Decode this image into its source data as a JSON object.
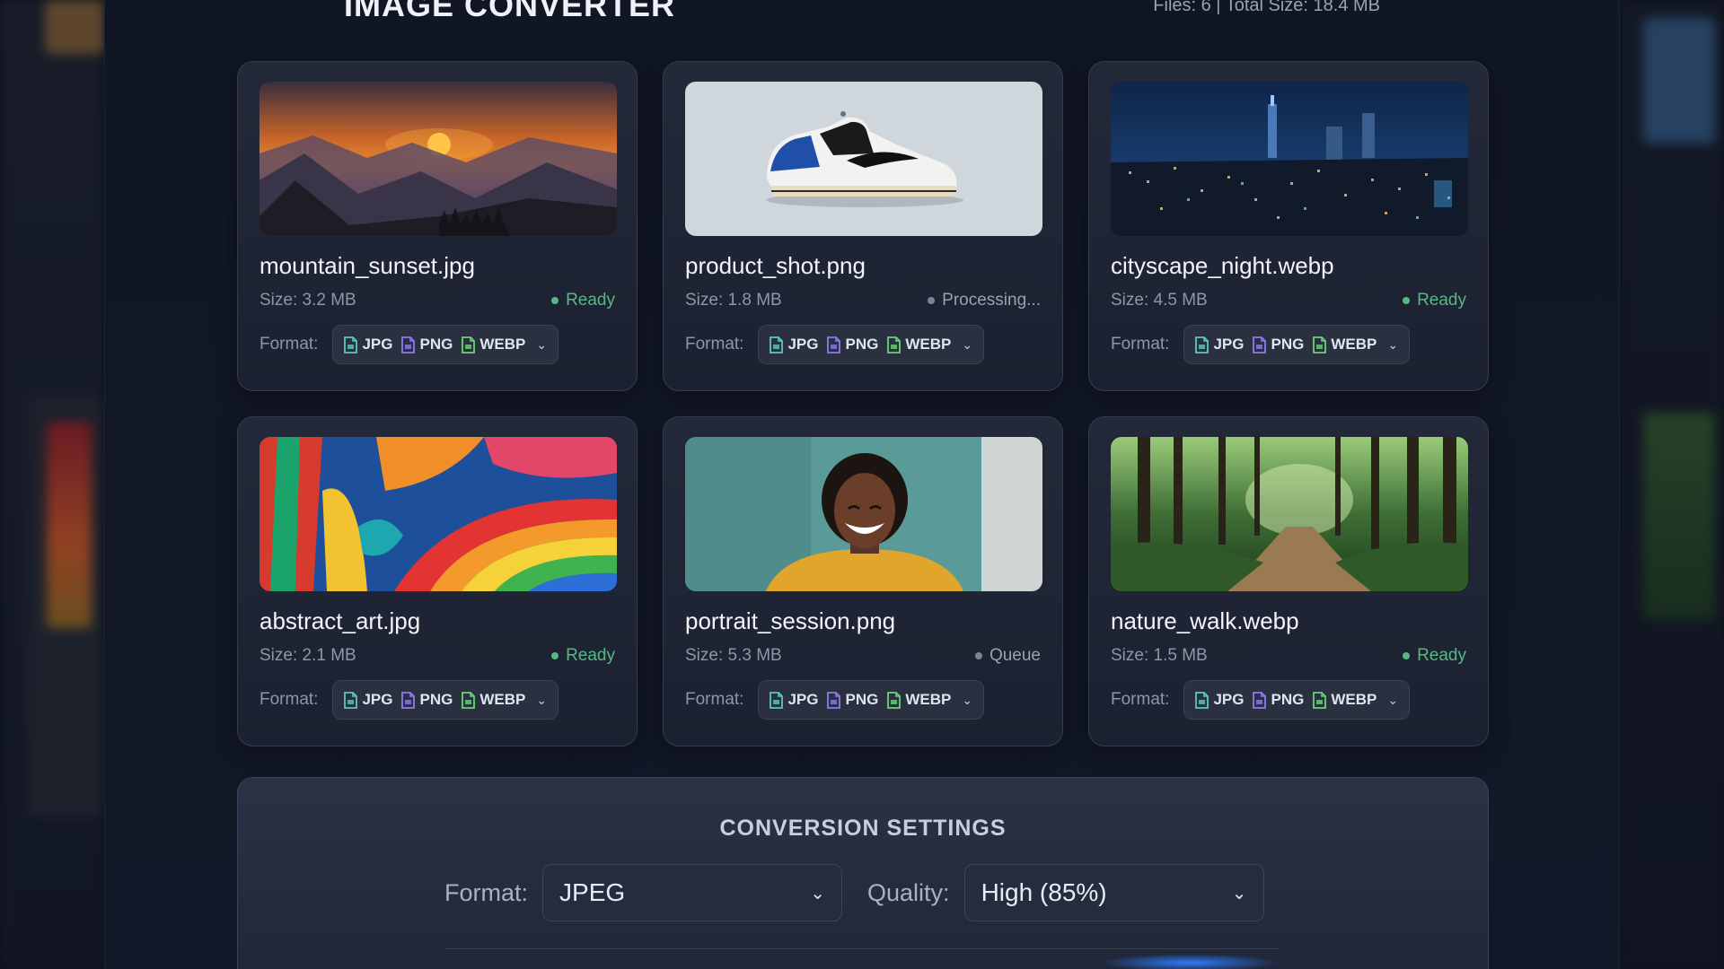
{
  "app": {
    "title": "IMAGE CONVERTER",
    "files_info": "Files: 6  |  Total Size: 18.4 MB"
  },
  "format_label": "Format:",
  "format_options": [
    "JPG",
    "PNG",
    "WEBP"
  ],
  "cards": [
    {
      "name": "mountain_sunset.jpg",
      "size": "Size: 3.2 MB",
      "status": "Ready",
      "status_kind": "ready",
      "thumb": "sunset-mountains"
    },
    {
      "name": "product_shot.png",
      "size": "Size: 1.8 MB",
      "status": "Processing...",
      "status_kind": "processing",
      "thumb": "sneaker"
    },
    {
      "name": "cityscape_night.webp",
      "size": "Size: 4.5 MB",
      "status": "Ready",
      "status_kind": "ready",
      "thumb": "city-night"
    },
    {
      "name": "abstract_art.jpg",
      "size": "Size: 2.1 MB",
      "status": "Ready",
      "status_kind": "ready",
      "thumb": "abstract-paint"
    },
    {
      "name": "portrait_session.png",
      "size": "Size: 5.3 MB",
      "status": "Queue",
      "status_kind": "queue",
      "thumb": "portrait"
    },
    {
      "name": "nature_walk.webp",
      "size": "Size: 1.5 MB",
      "status": "Ready",
      "status_kind": "ready",
      "thumb": "forest-path"
    }
  ],
  "settings": {
    "title": "CONVERSION SETTINGS",
    "format_label": "Format:",
    "format_value": "JPEG",
    "quality_label": "Quality:",
    "quality_value": "High (85%)"
  },
  "colors": {
    "ready": "#58b884",
    "jpg_icon": "#5cc8c0",
    "png_icon": "#8a7cf0",
    "webp_icon": "#6cd27a"
  }
}
